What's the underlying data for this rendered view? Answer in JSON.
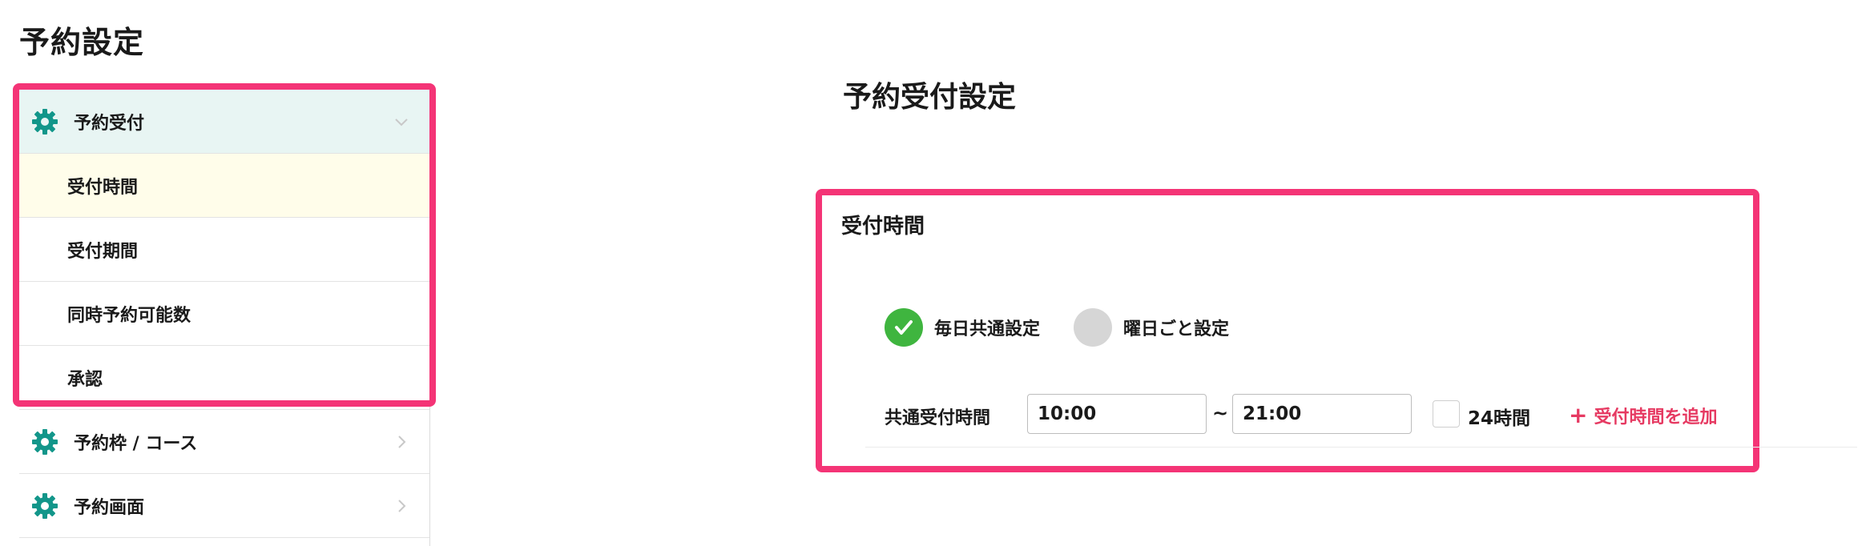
{
  "page": {
    "title": "予約設定"
  },
  "sidebar": {
    "items": [
      {
        "label": "予約受付",
        "icon": "gear-icon",
        "expanded": true
      },
      {
        "label": "受付時間",
        "sub": true,
        "selected": true
      },
      {
        "label": "受付期間",
        "sub": true
      },
      {
        "label": "同時予約可能数",
        "sub": true
      },
      {
        "label": "承認",
        "sub": true
      },
      {
        "label": "予約枠 / コース",
        "icon": "gear-icon"
      },
      {
        "label": "予約画面",
        "icon": "gear-icon"
      }
    ]
  },
  "main": {
    "section_title": "予約受付設定",
    "card": {
      "title": "受付時間",
      "options": [
        {
          "label": "毎日共通設定",
          "checked": true
        },
        {
          "label": "曜日ごと設定",
          "checked": false
        }
      ],
      "time_row": {
        "label": "共通受付時間",
        "start": "10:00",
        "separator": "~",
        "end": "21:00",
        "all_day_label": "24時間",
        "add_label": "受付時間を追加"
      }
    }
  },
  "colors": {
    "highlight": "#f43476",
    "gear": "#12968a",
    "check": "#3fb53f",
    "add": "#e63a62",
    "active_bg": "#e8f5f3",
    "selected_bg": "#fffdea"
  }
}
